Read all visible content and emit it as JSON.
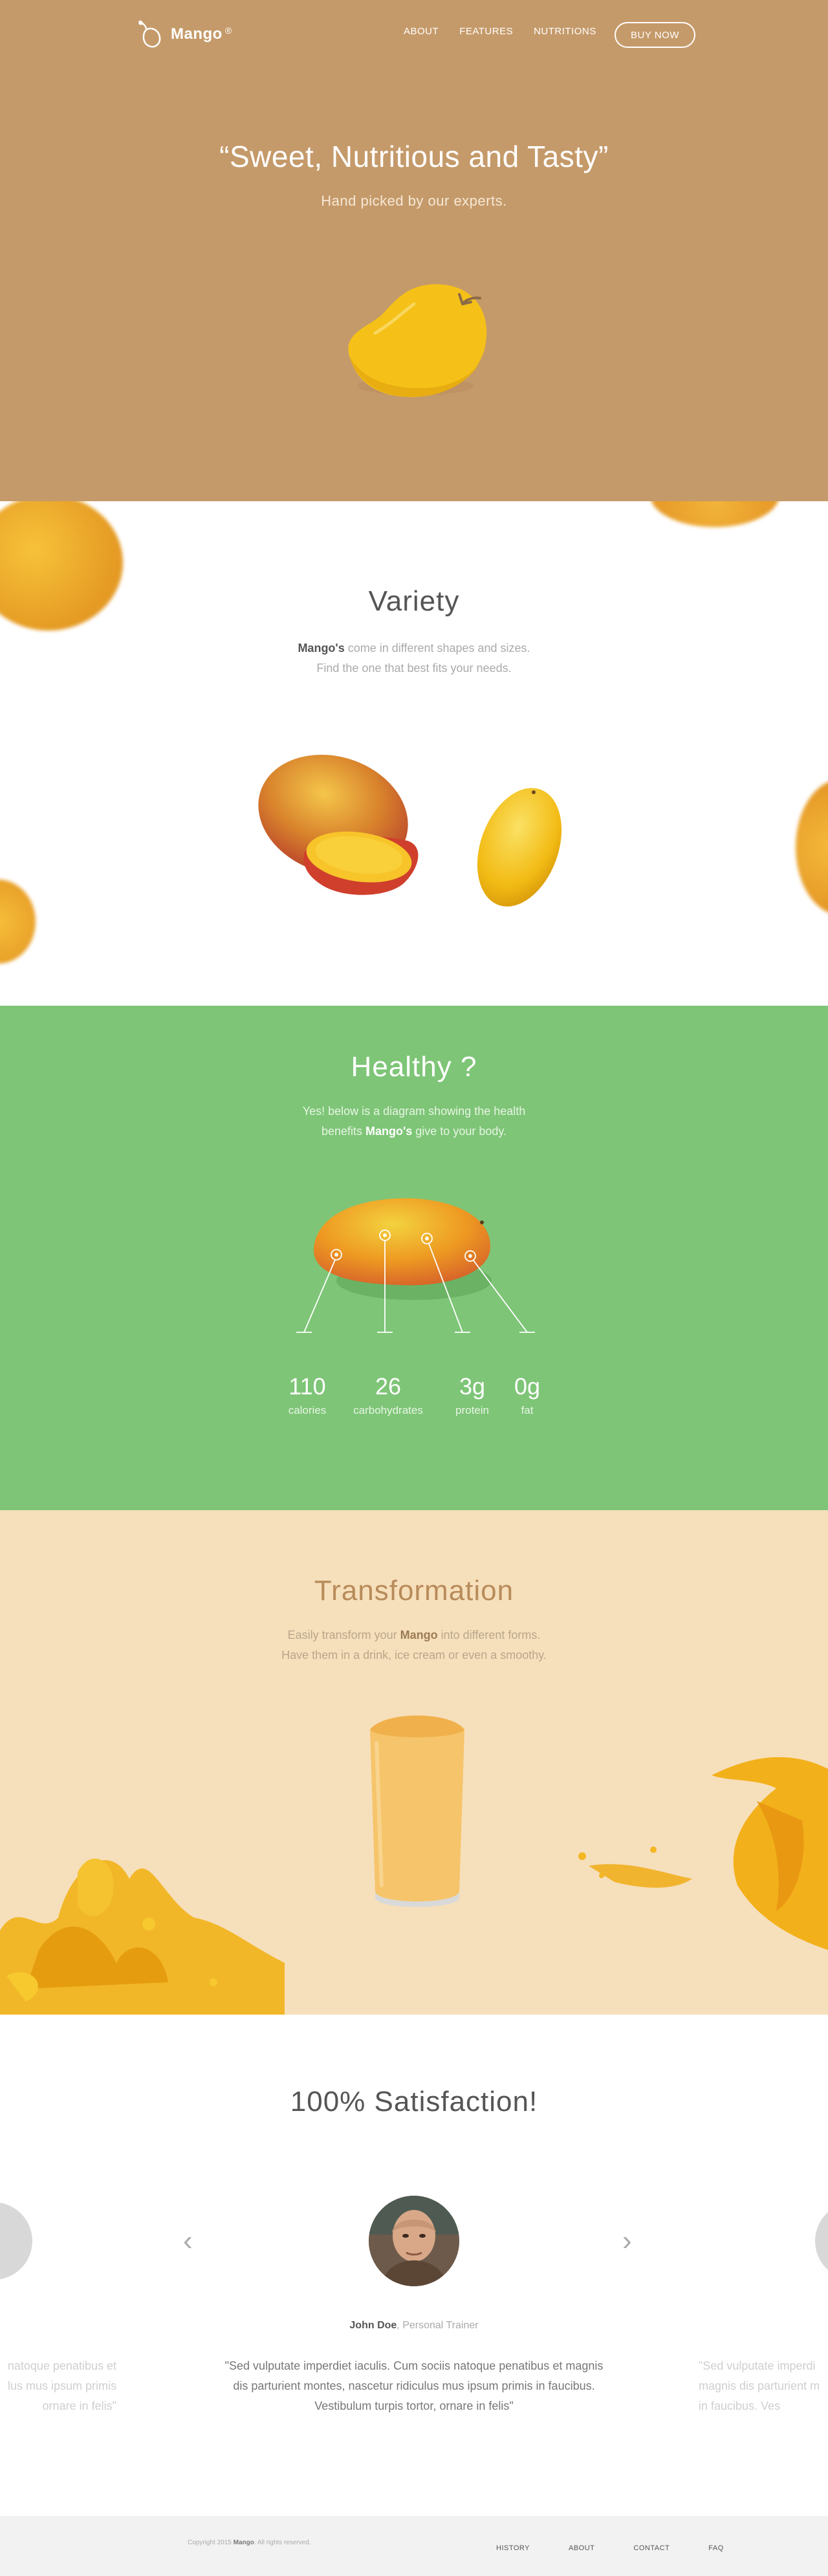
{
  "nav": {
    "brand": "Mango",
    "brand_mark": "®",
    "items": [
      {
        "label": "ABOUT"
      },
      {
        "label": "FEATURES"
      },
      {
        "label": "NUTRITIONS"
      }
    ],
    "buy_label": "BUY NOW"
  },
  "hero": {
    "title": "“Sweet, Nutritious and Tasty”",
    "subtitle": "Hand picked by our experts."
  },
  "variety": {
    "title": "Variety",
    "text_bold": "Mango's",
    "text_rest": " come in different shapes and sizes.",
    "text_line2": "Find the one that best fits your needs."
  },
  "healthy": {
    "title": "Healthy ?",
    "line1": "Yes! below is a diagram showing the health",
    "line2_pre": "benefits ",
    "line2_bold": "Mango's",
    "line2_post": " give to your body.",
    "stats": [
      {
        "value": "110",
        "label": "calories"
      },
      {
        "value": "26",
        "label": "carbohydrates"
      },
      {
        "value": "3g",
        "label": "protein"
      },
      {
        "value": "0g",
        "label": "fat"
      }
    ]
  },
  "transformation": {
    "title": "Transformation",
    "line1_pre": "Easily transform your ",
    "line1_bold": "Mango",
    "line1_post": " into different forms.",
    "line2": "Have them in a drink, ice cream or even a smoothy."
  },
  "satisfaction": {
    "title": "100% Satisfaction!",
    "prev_arrow": "‹",
    "next_arrow": "›",
    "person_name": "John Doe",
    "person_role": ", Personal Trainer",
    "quote": "\"Sed vulputate imperdiet iaculis. Cum sociis natoque penatibus et magnis dis parturient montes, nascetur ridiculus mus ipsum primis in faucibus. Vestibulum turpis tortor, ornare in felis\"",
    "quote_left": "natoque penatibus et\nlus mus ipsum primis\nornare in felis\"",
    "quote_right": "\"Sed vulputate imperdi\nmagnis dis parturient m\nin faucibus. Ves"
  },
  "footer": {
    "copyright_pre": "Copyright 2015 ",
    "copyright_brand": "Mango",
    "copyright_post": ". All rights reserved.",
    "links": [
      {
        "label": "HISTORY"
      },
      {
        "label": "ABOUT"
      },
      {
        "label": "CONTACT"
      },
      {
        "label": "FAQ"
      }
    ]
  },
  "colors": {
    "hero_bg": "#c59a6a",
    "healthy_bg": "#7ec577",
    "transform_bg": "#f6dfbb",
    "mango_yellow": "#f5c118"
  }
}
